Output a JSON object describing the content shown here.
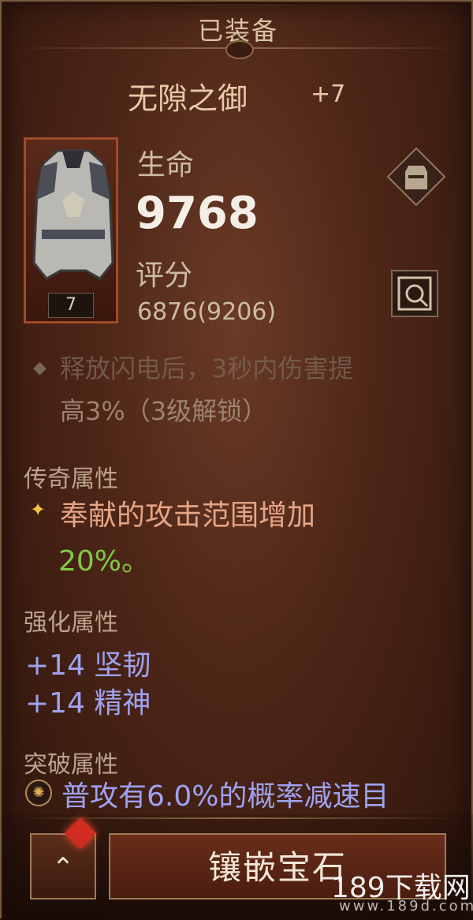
{
  "header": {
    "title": "已装备"
  },
  "item": {
    "name": "无隙之御",
    "plus": "+7",
    "level": "7"
  },
  "stats": {
    "life_label": "生命",
    "life_value": "9768",
    "score_label": "评分",
    "score_value": "6876(9206)"
  },
  "desc": {
    "line1": "释放闪电后，3秒内伤害提",
    "line2": "高3%（3级解锁）"
  },
  "legendary": {
    "label": "传奇属性",
    "text": "奉献的攻击范围增加",
    "percent": "20%。"
  },
  "enhance": {
    "label": "强化属性",
    "items": [
      "+14 坚韧",
      "+14 精神"
    ]
  },
  "breakthrough": {
    "label": "突破属性",
    "text": "普攻有6.0%的概率减速目"
  },
  "buttons": {
    "collapse": "⌃",
    "socket": "镶嵌宝石"
  },
  "icons": {
    "armor": "armor-icon",
    "compare": "compare-icon",
    "legend_bullet": "star-icon",
    "breakthrough": "burst-icon"
  },
  "watermark": {
    "main": "189下载网",
    "sub": "www.189d.com"
  }
}
